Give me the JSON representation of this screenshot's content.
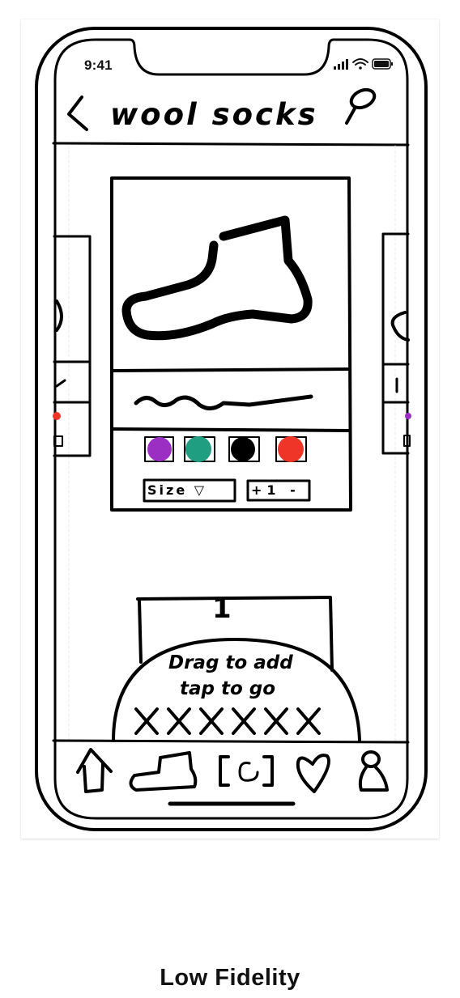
{
  "status_bar": {
    "time": "9:41"
  },
  "header": {
    "title": "wool socks"
  },
  "product": {
    "swatches": [
      {
        "name": "purple",
        "color": "#9b2fc4"
      },
      {
        "name": "teal",
        "color": "#1f9e82"
      },
      {
        "name": "black",
        "color": "#000000"
      },
      {
        "name": "red",
        "color": "#ee3528"
      }
    ],
    "size_label": "Size ▽",
    "quantity_label": "+1 -"
  },
  "cart": {
    "count": "1",
    "hint_line1": "Drag to add",
    "hint_line2": "tap to go",
    "item_marks": "XXXXXX"
  },
  "tab_bar": {
    "items": [
      {
        "name": "home",
        "icon": "home-icon"
      },
      {
        "name": "shop",
        "icon": "sock-icon"
      },
      {
        "name": "scan",
        "icon": "camera-icon"
      },
      {
        "name": "favorites",
        "icon": "heart-icon"
      },
      {
        "name": "profile",
        "icon": "person-icon"
      }
    ]
  },
  "caption": "Low Fidelity"
}
